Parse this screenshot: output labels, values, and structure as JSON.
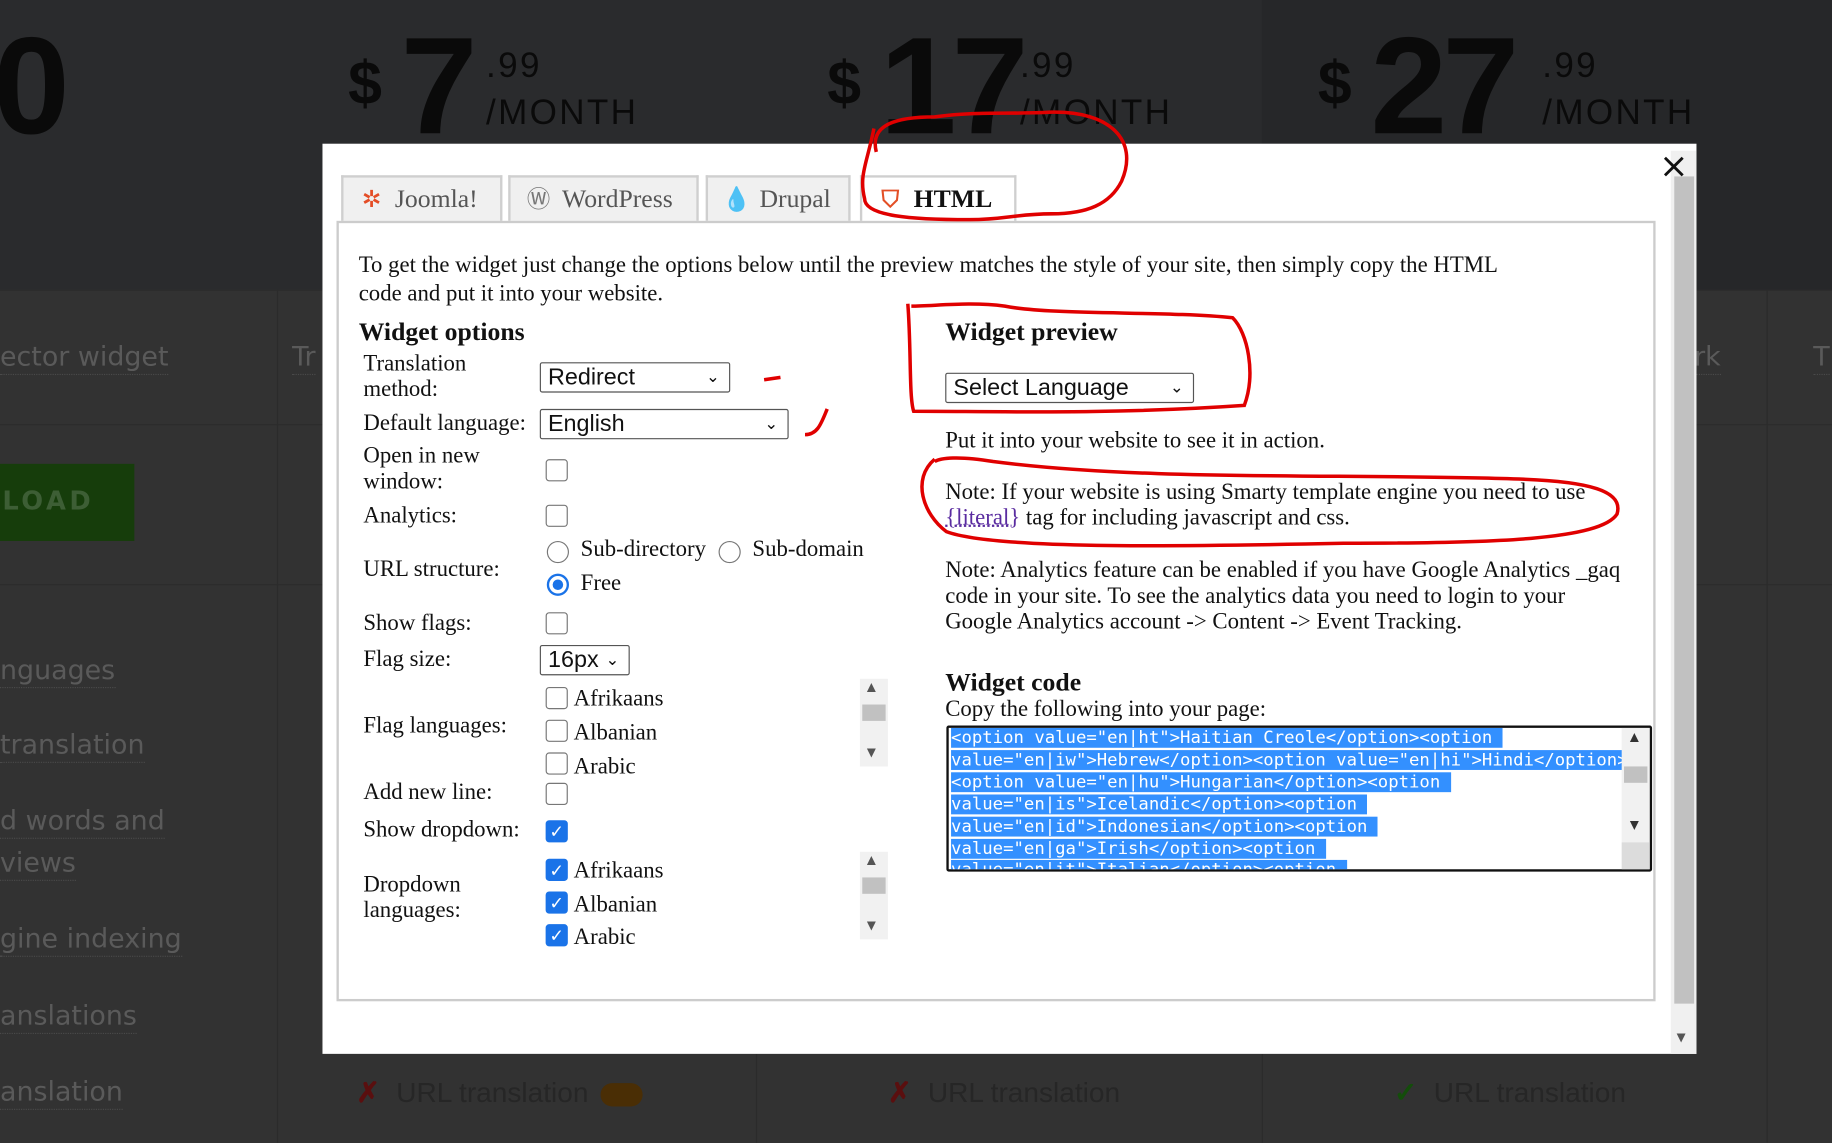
{
  "background": {
    "prices": [
      {
        "currency": "",
        "amount": "0",
        "cents": "",
        "period": ""
      },
      {
        "currency": "$",
        "amount": "7",
        "cents": ".99",
        "period": "/MONTH"
      },
      {
        "currency": "$",
        "amount": "17",
        "cents": ".99",
        "period": "/MONTH"
      },
      {
        "currency": "$",
        "amount": "27",
        "cents": ".99",
        "period": "/MONTH"
      }
    ],
    "row_headers": [
      "ector widget",
      "Tr",
      "rk",
      "T"
    ],
    "download_label": "LOAD",
    "features": [
      "nguages",
      "translation",
      "d words and",
      "views",
      "gine indexing",
      "anslations",
      "anslation"
    ],
    "url_features": [
      {
        "mark": "✗",
        "label": "URL translation",
        "status": "no"
      },
      {
        "mark": "✗",
        "label": "URL translation",
        "status": "no"
      },
      {
        "mark": "✓",
        "label": "URL translation",
        "status": "yes"
      }
    ]
  },
  "modal": {
    "close_icon": "×",
    "tabs": [
      {
        "label": "Joomla!",
        "icon": "joomla-icon",
        "active": false
      },
      {
        "label": "WordPress",
        "icon": "wordpress-icon",
        "active": false
      },
      {
        "label": "Drupal",
        "icon": "drupal-icon",
        "active": false
      },
      {
        "label": "HTML",
        "icon": "html5-icon",
        "active": true
      }
    ],
    "intro_line1": "To get the widget just change the options below until the preview matches the style of your site, then simply copy the HTML",
    "intro_line2": "code and put it into your website.",
    "options": {
      "title": "Widget options",
      "translation_method_label1": "Translation",
      "translation_method_label2": "method:",
      "translation_method_value": "Redirect",
      "default_language_label": "Default language:",
      "default_language_value": "English",
      "open_new_window_label1": "Open in new",
      "open_new_window_label2": "window:",
      "open_new_window_checked": false,
      "analytics_label": "Analytics:",
      "analytics_checked": false,
      "url_structure_label": "URL structure:",
      "url_options": [
        "Sub-directory",
        "Sub-domain",
        "Free"
      ],
      "url_selected": "Free",
      "show_flags_label": "Show flags:",
      "show_flags_checked": false,
      "flag_size_label": "Flag size:",
      "flag_size_value": "16px",
      "flag_languages_label": "Flag languages:",
      "flag_languages": [
        {
          "label": "Afrikaans",
          "checked": false
        },
        {
          "label": "Albanian",
          "checked": false
        },
        {
          "label": "Arabic",
          "checked": false
        }
      ],
      "add_new_line_label": "Add new line:",
      "add_new_line_checked": false,
      "show_dropdown_label": "Show dropdown:",
      "show_dropdown_checked": true,
      "dropdown_languages_label1": "Dropdown",
      "dropdown_languages_label2": "languages:",
      "dropdown_languages": [
        {
          "label": "Afrikaans",
          "checked": true
        },
        {
          "label": "Albanian",
          "checked": true
        },
        {
          "label": "Arabic",
          "checked": true
        }
      ]
    },
    "preview": {
      "title": "Widget preview",
      "select_value": "Select Language",
      "hint": "Put it into your website to see it in action.",
      "note1_line1": "Note: If your website is using Smarty template engine you need to use",
      "note1_link": "{literal}",
      "note1_line2": " tag for including javascript and css.",
      "note2_line1": "Note: Analytics feature can be enabled if you have Google Analytics _gaq",
      "note2_line2": "code in your site. To see the analytics data you need to login to your",
      "note2_line3": "Google Analytics account -> Content -> Event Tracking."
    },
    "code": {
      "title": "Widget code",
      "instruction": "Copy the following into your page:",
      "lines": [
        "<option value=\"en|ht\">Haitian Creole</option><option ",
        "value=\"en|iw\">Hebrew</option><option value=\"en|hi\">Hindi</option>",
        "<option value=\"en|hu\">Hungarian</option><option ",
        "value=\"en|is\">Icelandic</option><option ",
        "value=\"en|id\">Indonesian</option><option ",
        "value=\"en|ga\">Irish</option><option ",
        "value=\"en|it\">Italian</option><option "
      ]
    }
  },
  "colors": {
    "annotation": "#e00000",
    "accent": "#1a73e8",
    "selection": "#3390ff"
  }
}
